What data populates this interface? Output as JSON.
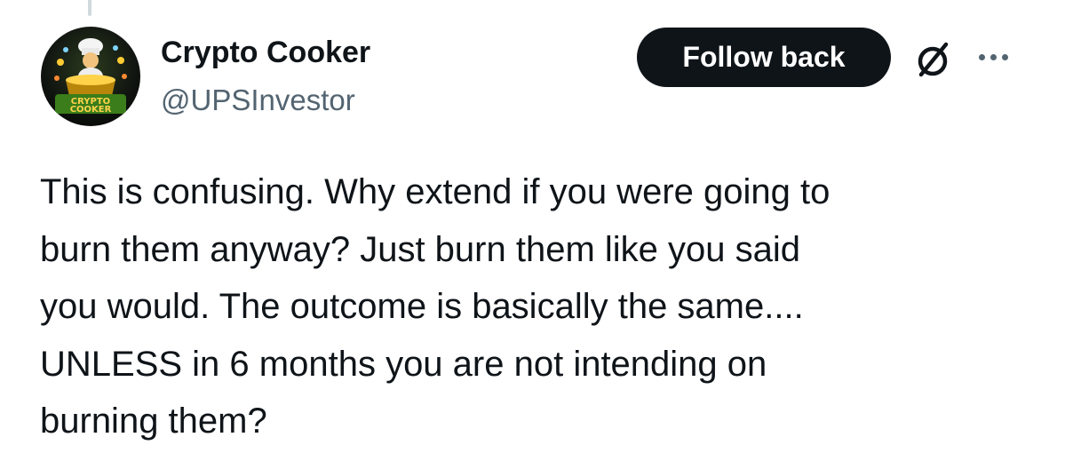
{
  "author": {
    "name": "Crypto Cooker",
    "handle": "@UPSInvestor",
    "avatar_text": [
      "CRYPTO",
      "COOKER"
    ]
  },
  "actions": {
    "follow_label": "Follow back",
    "grok_icon": "slash-circle-icon",
    "more_icon": "more-horizontal-icon"
  },
  "tweet": {
    "lines": [
      "This is confusing. Why extend if you were going to",
      "burn them anyway? Just burn them like you said",
      "you would. The outcome is basically the same....",
      "UNLESS in 6 months you are not intending on",
      "burning them?"
    ]
  },
  "colors": {
    "text_primary": "#0f1419",
    "text_secondary": "#536471",
    "button_bg": "#0f1419",
    "button_text": "#ffffff",
    "thread_line": "#cfd9de"
  }
}
